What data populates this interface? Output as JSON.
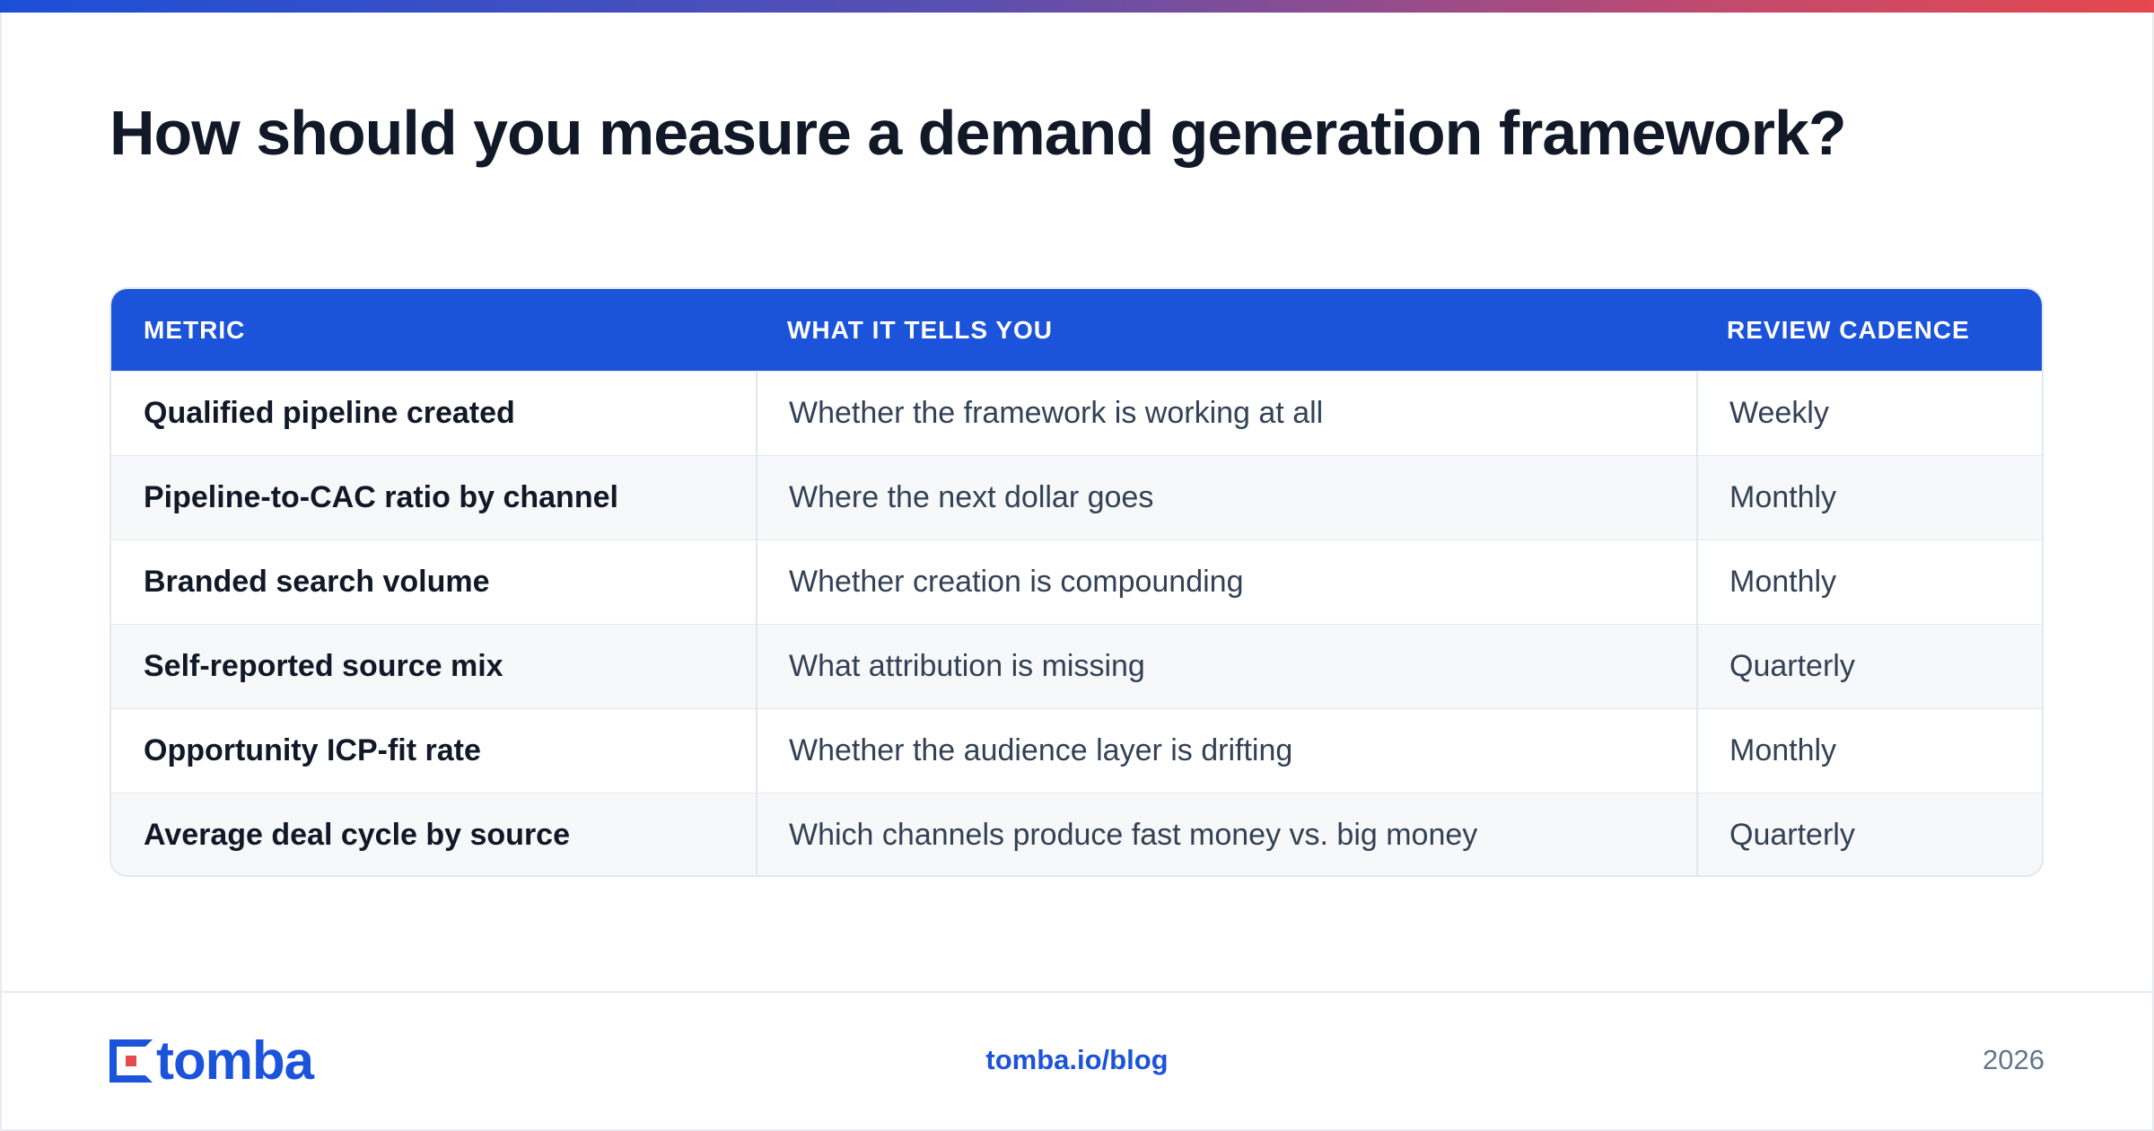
{
  "title": "How should you measure a demand generation framework?",
  "table": {
    "headers": {
      "metric": "METRIC",
      "what": "WHAT IT TELLS YOU",
      "cadence": "REVIEW CADENCE"
    },
    "rows": [
      {
        "metric": "Qualified pipeline created",
        "what": "Whether the framework is working at all",
        "cadence": "Weekly"
      },
      {
        "metric": "Pipeline-to-CAC ratio by channel",
        "what": "Where the next dollar goes",
        "cadence": "Monthly"
      },
      {
        "metric": "Branded search volume",
        "what": "Whether creation is compounding",
        "cadence": "Monthly"
      },
      {
        "metric": "Self-reported source mix",
        "what": "What attribution is missing",
        "cadence": "Quarterly"
      },
      {
        "metric": "Opportunity ICP-fit rate",
        "what": "Whether the audience layer is drifting",
        "cadence": "Monthly"
      },
      {
        "metric": "Average deal cycle by source",
        "what": "Which channels produce fast money vs. big money",
        "cadence": "Quarterly"
      }
    ]
  },
  "footer": {
    "logo_text": "tomba",
    "link": "tomba.io/blog",
    "year": "2026"
  },
  "colors": {
    "accent": "#1b53db",
    "brand_red": "#e5484d"
  }
}
